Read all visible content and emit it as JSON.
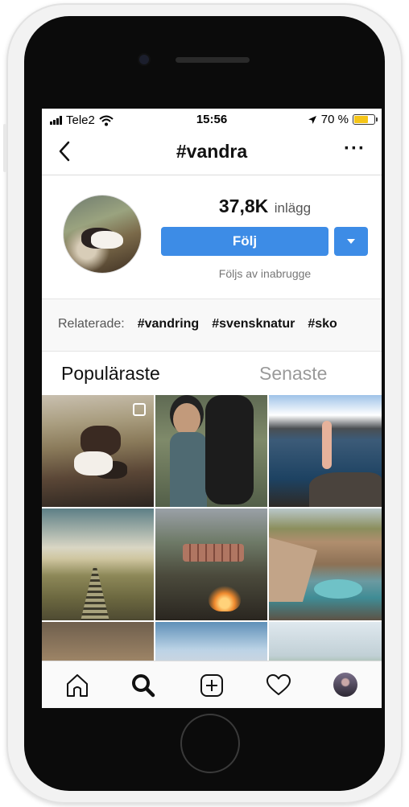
{
  "status_bar": {
    "carrier": "Tele2",
    "time": "15:56",
    "battery_percent": "70 %",
    "battery_level": 0.7,
    "icons": [
      "signal-icon",
      "wifi-icon",
      "location-arrow-icon",
      "battery-icon"
    ]
  },
  "header": {
    "title": "#vandra",
    "back_icon": "chevron-left-icon",
    "more_label": "···"
  },
  "profile": {
    "post_count": "37,8K",
    "post_label": "inlägg",
    "follow_label": "Följ",
    "followed_by": "Följs av inabrugge"
  },
  "related": {
    "label": "Relaterade:",
    "tags": [
      "#vandring",
      "#svensknatur",
      "#sko"
    ]
  },
  "tabs": {
    "popular": "Populäraste",
    "recent": "Senaste",
    "active": "popular"
  },
  "grid": {
    "posts": 9,
    "first_post_icon": "multiple-photos-icon"
  },
  "bottom_nav": {
    "items": [
      "home-icon",
      "search-icon",
      "new-post-icon",
      "activity-heart-icon",
      "profile-avatar"
    ],
    "active": "search-icon"
  },
  "colors": {
    "accent": "#3d8ce6",
    "battery_fill": "#f5c518",
    "muted_text": "#9a9a9a"
  }
}
